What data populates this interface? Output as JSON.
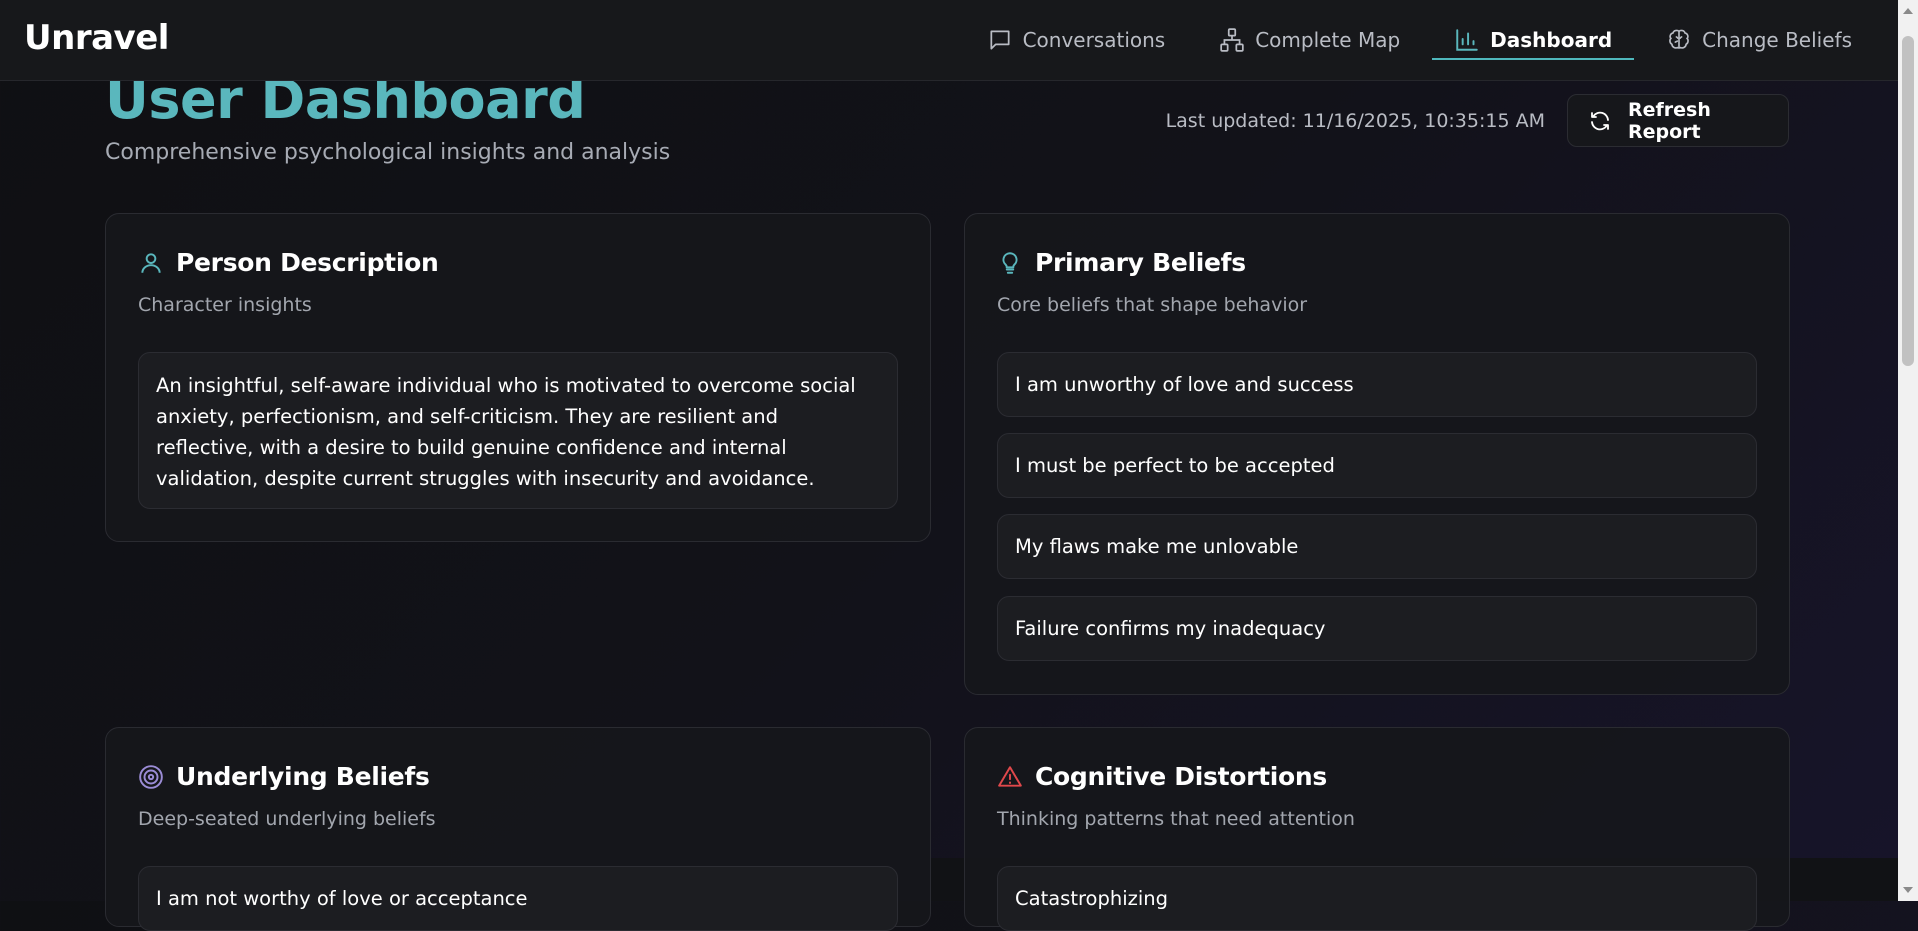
{
  "app": {
    "brand": "Unravel"
  },
  "nav": {
    "items": [
      {
        "label": "Conversations",
        "icon": "chat-bubble-icon"
      },
      {
        "label": "Complete Map",
        "icon": "network-icon"
      },
      {
        "label": "Dashboard",
        "icon": "bar-chart-icon",
        "active": true
      },
      {
        "label": "Change Beliefs",
        "icon": "brain-icon"
      }
    ]
  },
  "header": {
    "title": "User Dashboard",
    "subtitle": "Comprehensive psychological insights and analysis",
    "last_updated": "Last updated: 11/16/2025, 10:35:15 AM",
    "refresh_label": "Refresh Report"
  },
  "cards": {
    "person": {
      "title": "Person Description",
      "subtitle": "Character insights",
      "text": "An insightful, self-aware individual who is motivated to overcome social anxiety, perfectionism, and self-criticism. They are resilient and reflective, with a desire to build genuine confidence and internal validation, despite current struggles with insecurity and avoidance."
    },
    "primary": {
      "title": "Primary Beliefs",
      "subtitle": "Core beliefs that shape behavior",
      "items": [
        "I am unworthy of love and success",
        "I must be perfect to be accepted",
        "My flaws make me unlovable",
        "Failure confirms my inadequacy"
      ]
    },
    "underlying": {
      "title": "Underlying Beliefs",
      "subtitle": "Deep-seated underlying beliefs",
      "items": [
        "I am not worthy of love or acceptance"
      ]
    },
    "distortions": {
      "title": "Cognitive Distortions",
      "subtitle": "Thinking patterns that need attention",
      "items": [
        "Catastrophizing"
      ]
    }
  },
  "colors": {
    "accent": "#5ab7bd",
    "warning": "#e0484b",
    "target": "#9b8cd6"
  }
}
